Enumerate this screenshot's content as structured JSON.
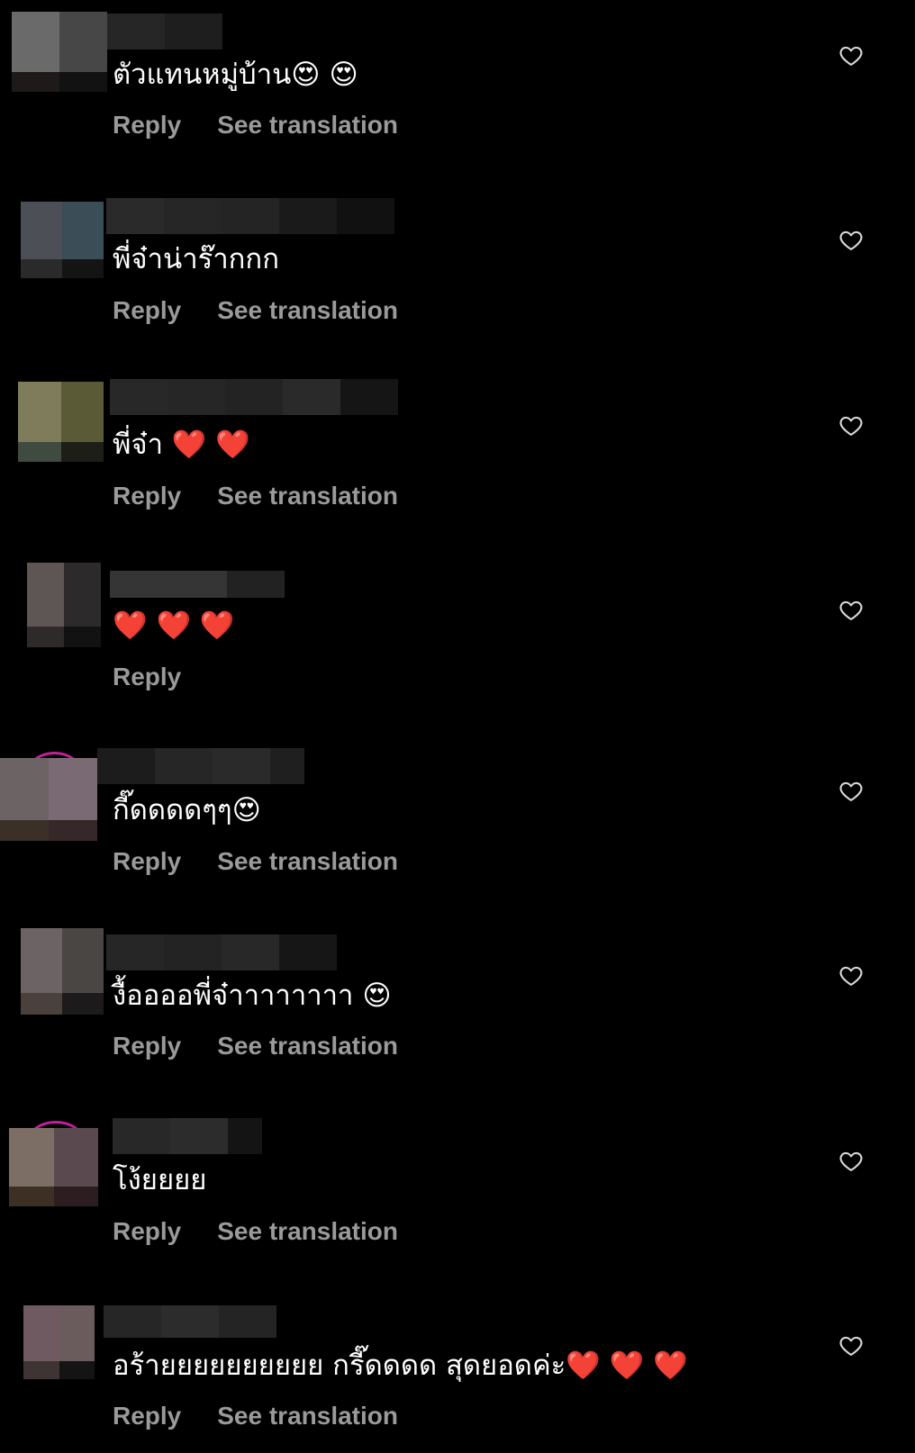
{
  "comments": [
    {
      "text": "ตัวแทนหมู่บ้าน😍 😍",
      "reply": "Reply",
      "translate": "See translation"
    },
    {
      "text": "พี่จ๋าน่าร๊ากกก",
      "reply": "Reply",
      "translate": "See translation"
    },
    {
      "text": "พี่จ๋า ❤️ ❤️",
      "reply": "Reply",
      "translate": "See translation"
    },
    {
      "text": "❤️ ❤️ ❤️",
      "reply": "Reply"
    },
    {
      "text": "กี๊ดดดดๆๆ😍",
      "reply": "Reply",
      "translate": "See translation"
    },
    {
      "text": "งื้ออออพี่จ๋าาาาาาาา 😍",
      "reply": "Reply",
      "translate": "See translation"
    },
    {
      "text": "โง้ยยยย",
      "reply": "Reply",
      "translate": "See translation"
    },
    {
      "text": "อร้ายยยยยยยยยย  กรี๊ดดดด สุดยอดค่ะ❤️ ❤️ ❤️",
      "reply": "Reply",
      "translate": "See translation"
    }
  ],
  "icons": {
    "like": "heart-outline-icon"
  },
  "colors": {
    "background": "#000000",
    "text": "#ffffff",
    "secondary": "#9a9a9a",
    "story_ring": "#c0209a"
  }
}
